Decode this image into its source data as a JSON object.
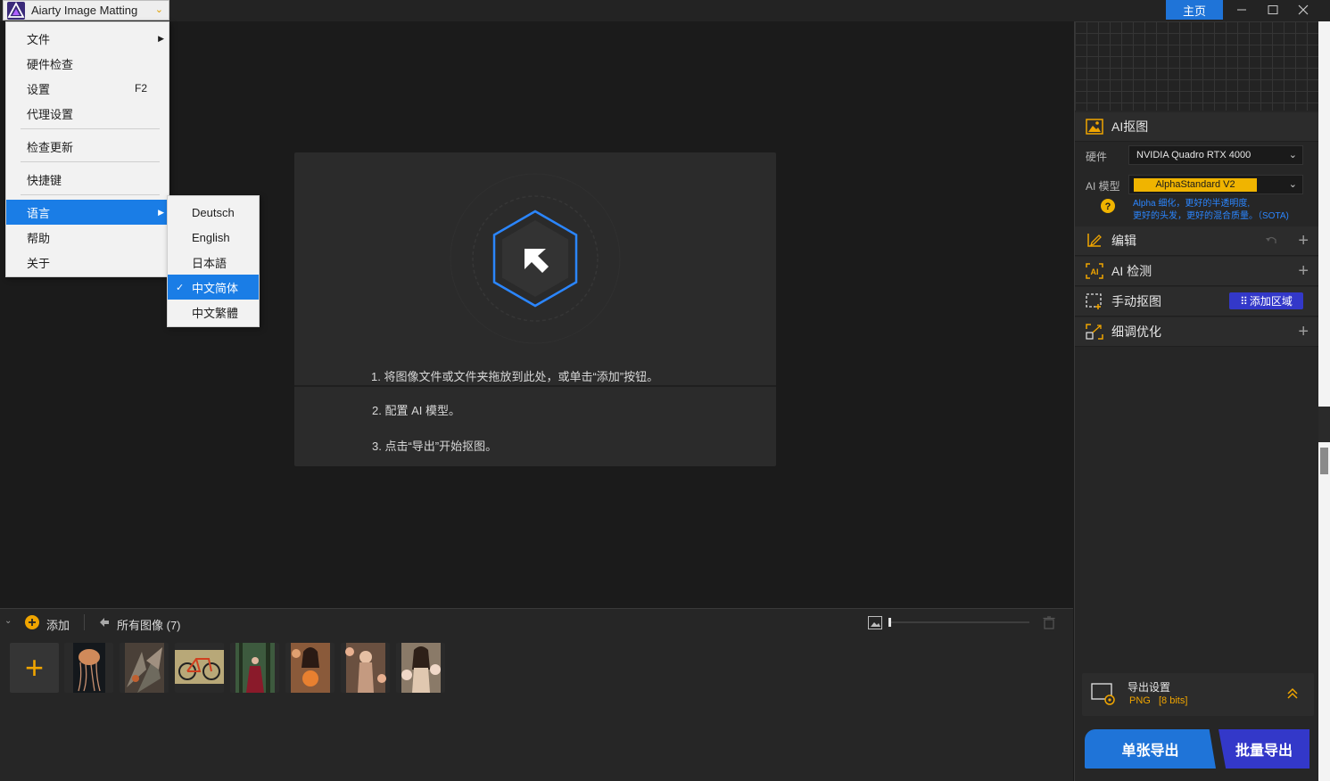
{
  "app": {
    "title": "Aiarty Image Matting",
    "home_label": "主页"
  },
  "main_menu": {
    "file": "文件",
    "hardware_check": "硬件检查",
    "settings": "设置",
    "settings_shortcut": "F2",
    "proxy": "代理设置",
    "check_update": "检查更新",
    "shortcuts": "快捷键",
    "language": "语言",
    "help": "帮助",
    "about": "关于"
  },
  "language_menu": {
    "items": [
      "Deutsch",
      "English",
      "日本語",
      "中文简体",
      "中文繁體"
    ],
    "selected": "中文简体"
  },
  "drop_hints": {
    "step1": "1. 将图像文件或文件夹拖放到此处，或单击“添加”按钮。",
    "step2": "2. 配置 AI 模型。",
    "step3": "3. 点击“导出”开始抠图。"
  },
  "bottom": {
    "add_label": "添加",
    "all_images_label": "所有图像 (7)",
    "thumb_colors": [
      "#1a1f24",
      "#4a4038",
      "#8a7a50",
      "#3d5a3e",
      "#8a5a3a",
      "#6a5040",
      "#8a7a68"
    ]
  },
  "right_panel": {
    "ai_matting": {
      "title": "AI抠图",
      "hardware_label": "硬件",
      "hardware_value": "NVIDIA Quadro RTX 4000",
      "model_label": "AI 模型",
      "model_value": "AlphaStandard  V2",
      "model_desc_line1": "Alpha 细化，更好的半透明度,",
      "model_desc_line2": "更好的头发，更好的混合质量。（SOTA)"
    },
    "edit": {
      "title": "编辑"
    },
    "ai_detect": {
      "title": "AI 检测"
    },
    "manual": {
      "title": "手动抠图",
      "add_region": "添加区域"
    },
    "refine": {
      "title": "细调优化"
    },
    "export": {
      "title": "导出设置",
      "format": "PNG",
      "bits": "[8 bits]",
      "single_label": "单张导出",
      "batch_label": "批量导出"
    }
  },
  "colors": {
    "accent_blue": "#1f74d8",
    "accent_orange": "#f0a500",
    "batch_purple": "#3338c9"
  }
}
